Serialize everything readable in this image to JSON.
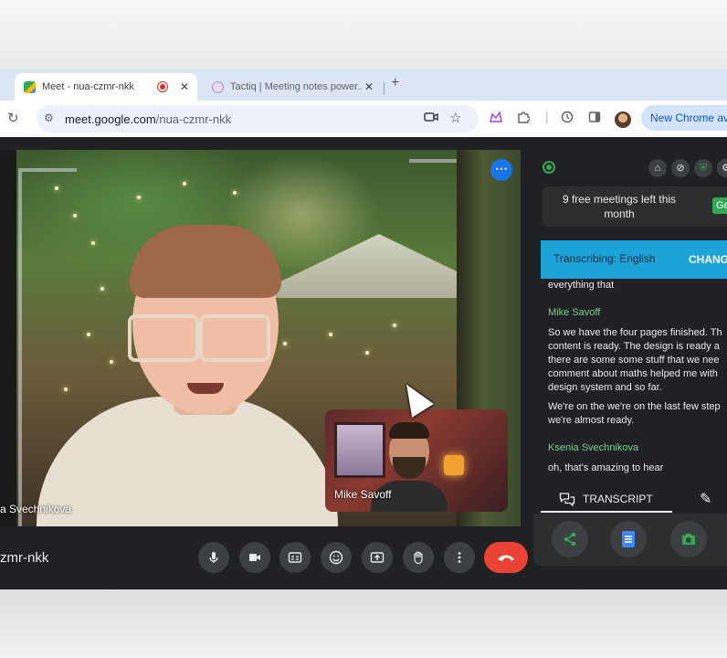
{
  "browser": {
    "tabs": [
      {
        "title": "Meet - nua-czmr-nkk",
        "active": true
      },
      {
        "title": "Tactiq | Meeting notes power...",
        "active": false
      }
    ],
    "url_host": "meet.google.com",
    "url_path": "/nua-czmr-nkk",
    "new_chrome_label": "New Chrome av"
  },
  "meet": {
    "main_participant": "a Svechnikova",
    "pip_participant": "Mike Savoff",
    "meeting_code": "zmr-nkk",
    "controls": [
      "mic-icon",
      "camera-icon",
      "captions-icon",
      "emoji-icon",
      "present-icon",
      "raise-hand-icon",
      "more-vert-icon",
      "end-call-icon"
    ]
  },
  "tactiq": {
    "free_meetings": "9 free meetings left this month",
    "get_label": "Ge",
    "banner_label": "Transcribing: English",
    "banner_change": "CHANG",
    "transcript": [
      {
        "type": "text",
        "lines": [
          "everything that"
        ]
      },
      {
        "type": "speaker",
        "name": "Mike Savoff"
      },
      {
        "type": "text",
        "lines": [
          "So we have the four pages finished. Th",
          "content is ready. The design is ready a",
          "there are some some stuff that we nee",
          "comment about maths helped me with",
          "design system and so far."
        ]
      },
      {
        "type": "text",
        "lines": [
          "We're on the we're on the last few step",
          "we're almost ready."
        ]
      },
      {
        "type": "speaker",
        "name": "Ksenia Svechnikova"
      },
      {
        "type": "text",
        "lines": [
          "oh, that's amazing to hear"
        ]
      }
    ],
    "tab_transcript": "TRANSCRIPT"
  },
  "colors": {
    "accent_green": "#34a853",
    "banner_blue": "#1ea3d8",
    "end_call_red": "#ea4335",
    "speaker_green": "#81c995"
  }
}
